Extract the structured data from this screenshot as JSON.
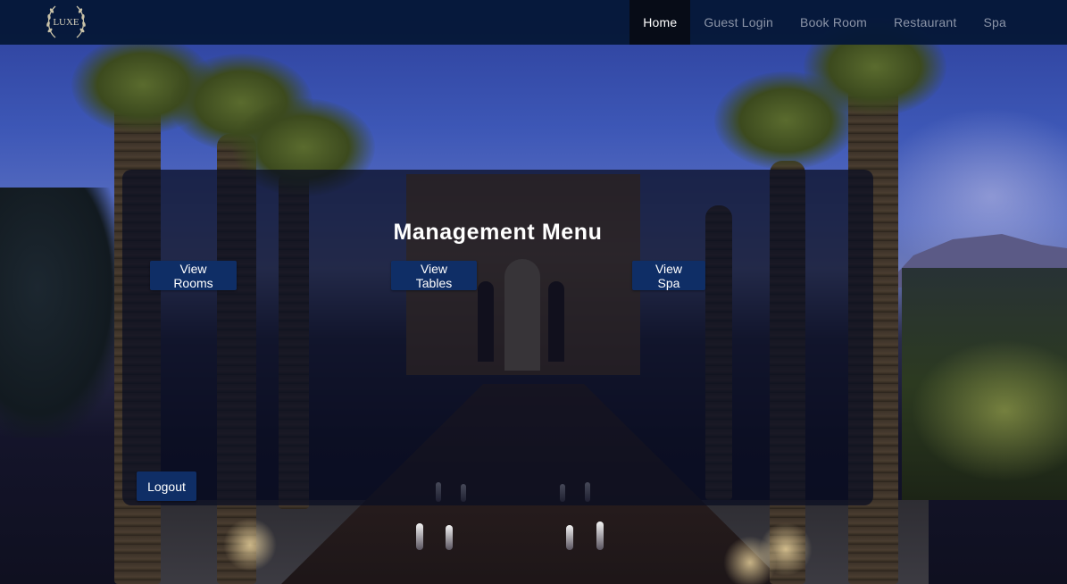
{
  "brand": {
    "logo_text": "LUXE"
  },
  "nav": {
    "items": [
      {
        "label": "Home",
        "active": true
      },
      {
        "label": "Guest Login",
        "active": false
      },
      {
        "label": "Book Room",
        "active": false
      },
      {
        "label": "Restaurant",
        "active": false
      },
      {
        "label": "Spa",
        "active": false
      }
    ]
  },
  "panel": {
    "title": "Management Menu",
    "buttons": {
      "view_rooms": "View Rooms",
      "view_tables": "View Tables",
      "view_spa": "View Spa",
      "logout": "Logout"
    }
  },
  "colors": {
    "navbar_bg": "#051838",
    "nav_active_bg": "#070c17",
    "button_bg": "#0f2e66",
    "panel_bg": "#0a0e22"
  },
  "icons": {
    "logo": "laurel-wreath-logo-icon"
  }
}
